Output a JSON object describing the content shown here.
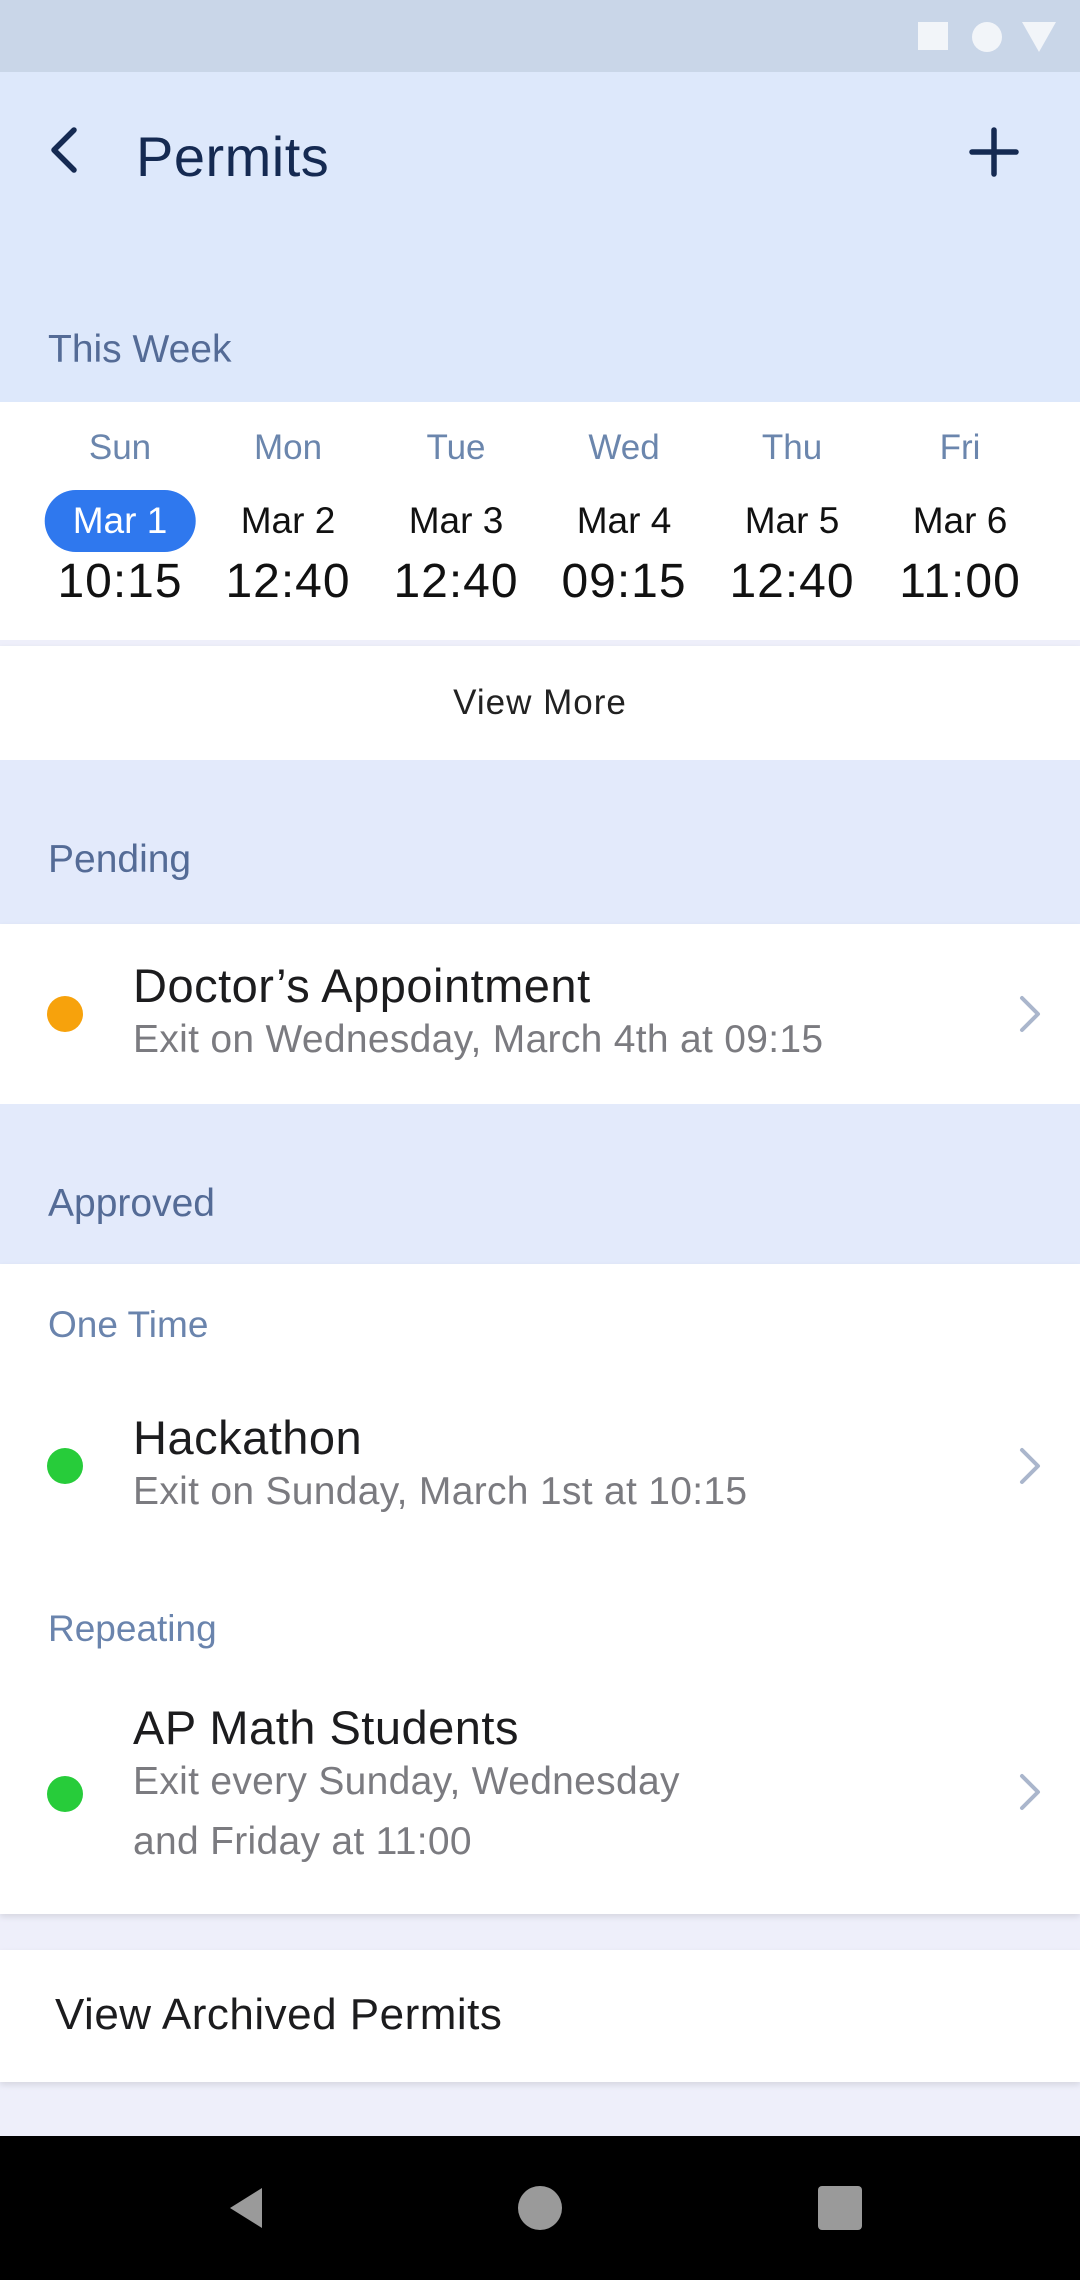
{
  "header": {
    "title": "Permits"
  },
  "this_week": {
    "label": "This Week",
    "days": [
      {
        "day": "Sun",
        "date": "Mar 1",
        "time": "10:15",
        "selected": true
      },
      {
        "day": "Mon",
        "date": "Mar 2",
        "time": "12:40",
        "selected": false
      },
      {
        "day": "Tue",
        "date": "Mar 3",
        "time": "12:40",
        "selected": false
      },
      {
        "day": "Wed",
        "date": "Mar 4",
        "time": "09:15",
        "selected": false
      },
      {
        "day": "Thu",
        "date": "Mar 5",
        "time": "12:40",
        "selected": false
      },
      {
        "day": "Fri",
        "date": "Mar 6",
        "time": "11:00",
        "selected": false
      }
    ],
    "view_more_label": "View More"
  },
  "pending": {
    "label": "Pending",
    "items": [
      {
        "title": "Doctor’s Appointment",
        "subtitle": "Exit on Wednesday, March 4th at 09:15",
        "status_color": "#f7a20c"
      }
    ]
  },
  "approved": {
    "label": "Approved",
    "one_time": {
      "label": "One Time",
      "items": [
        {
          "title": "Hackathon",
          "subtitle": "Exit on Sunday, March 1st at 10:15",
          "status_color": "#27cc3a"
        }
      ]
    },
    "repeating": {
      "label": "Repeating",
      "items": [
        {
          "title": "AP Math Students",
          "subtitle_line1": "Exit every Sunday, Wednesday",
          "subtitle_line2": "and Friday at 11:00",
          "status_color": "#27cc3a"
        }
      ]
    }
  },
  "archived_label": "View Archived Permits",
  "colors": {
    "accent": "#2f78ee",
    "pending": "#f7a20c",
    "approved": "#27cc3a",
    "header_bg": "#dde8fb"
  },
  "icons": {
    "back": "chevron-left-icon",
    "add": "plus-icon",
    "row": "chevron-right-icon"
  }
}
